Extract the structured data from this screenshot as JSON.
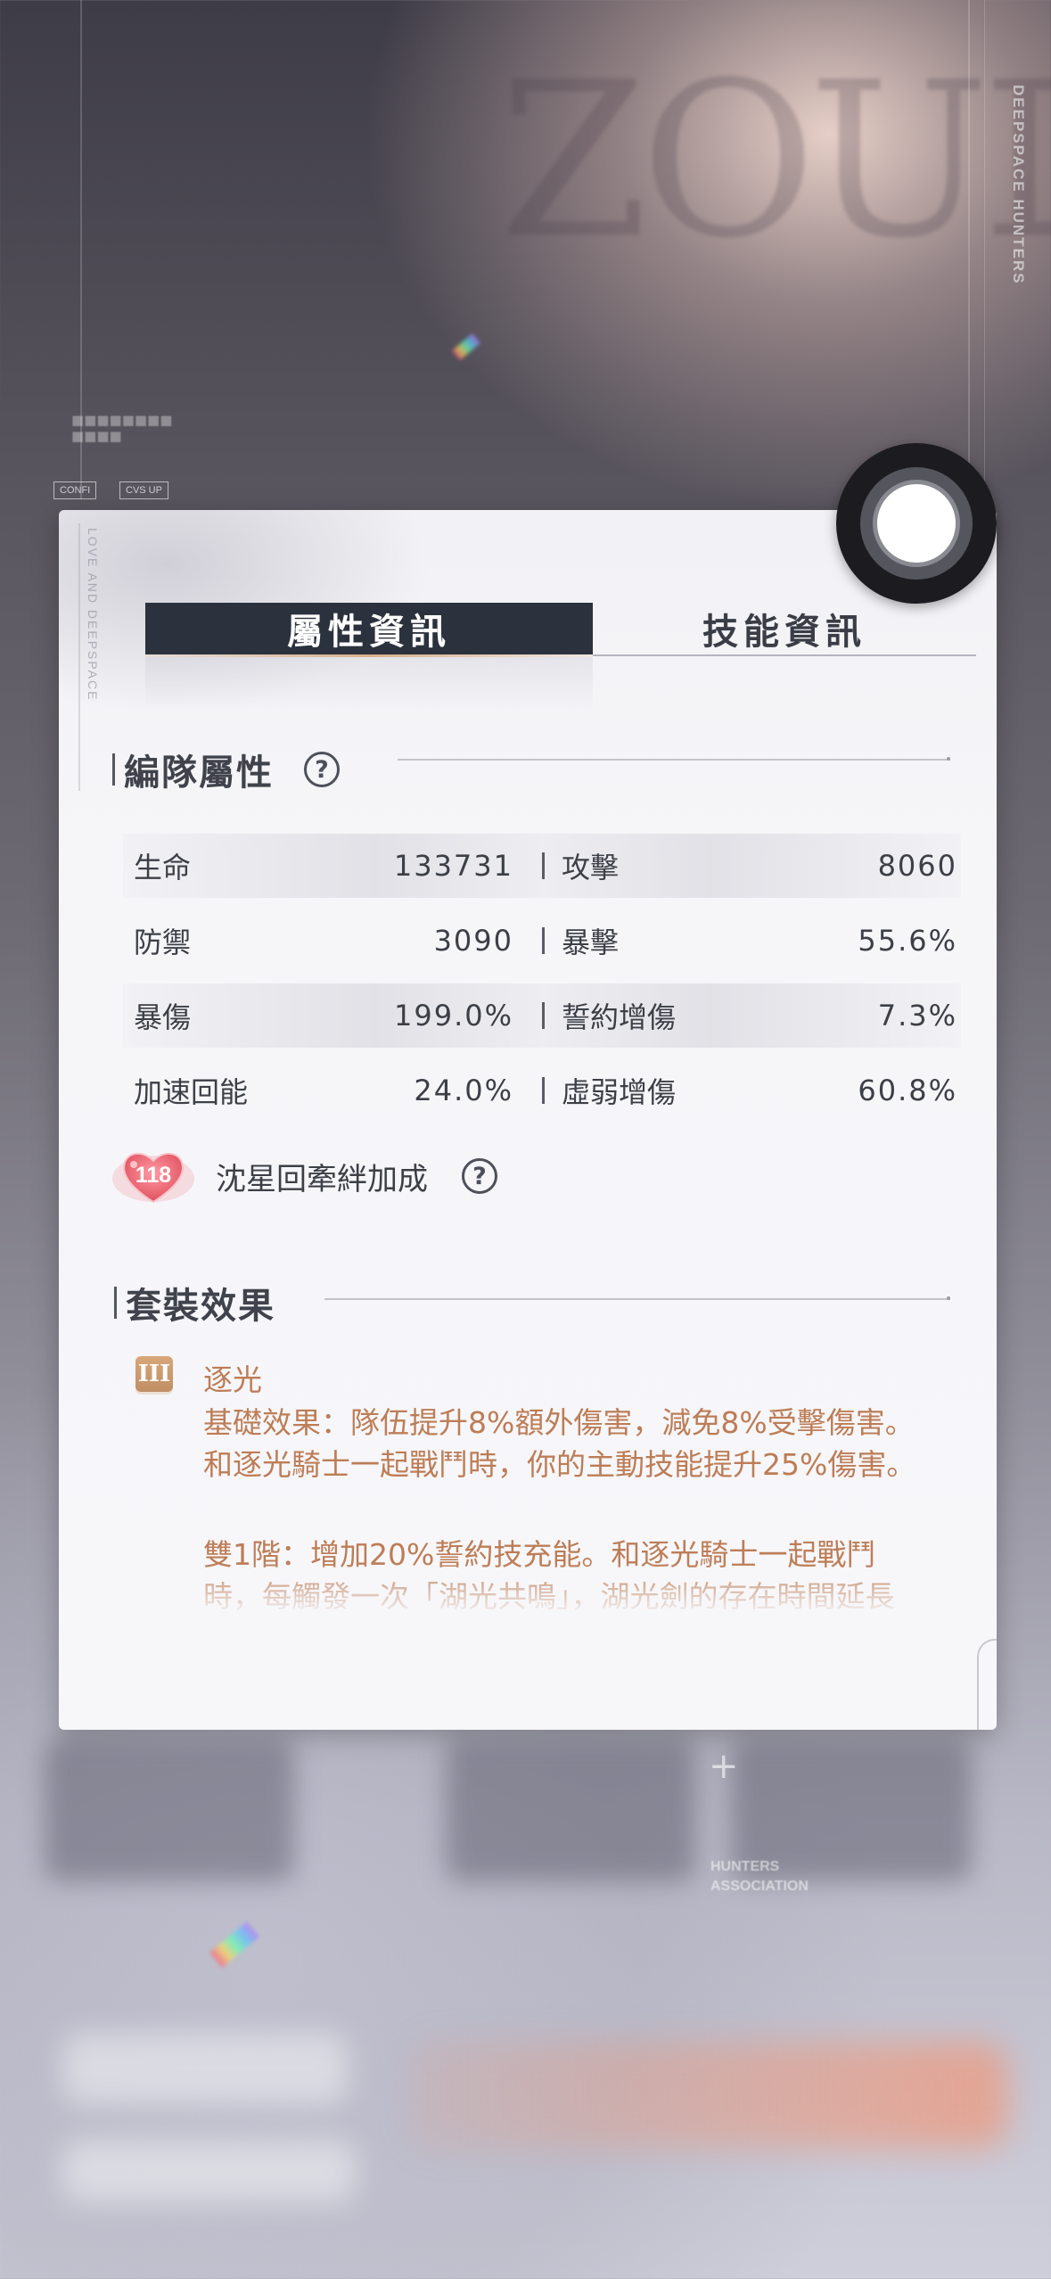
{
  "background": {
    "brand_vertical": "DEEPSPACE HUNTERS",
    "hunters_label": "HUNTERS\nASSOCIATION",
    "tags": [
      "CONFI",
      "CVS UP"
    ]
  },
  "panel": {
    "vertical_text": "LOVE AND DEEPSPACE",
    "tabs": [
      {
        "label": "屬性資訊",
        "active": true
      },
      {
        "label": "技能資訊",
        "active": false
      }
    ],
    "team_stats": {
      "title": "編隊屬性",
      "help": "?",
      "rows": [
        {
          "left": {
            "label": "生命",
            "value": "133731"
          },
          "right": {
            "label": "攻擊",
            "value": "8060"
          }
        },
        {
          "left": {
            "label": "防禦",
            "value": "3090"
          },
          "right": {
            "label": "暴擊",
            "value": "55.6%"
          }
        },
        {
          "left": {
            "label": "暴傷",
            "value": "199.0%"
          },
          "right": {
            "label": "誓約增傷",
            "value": "7.3%"
          }
        },
        {
          "left": {
            "label": "加速回能",
            "value": "24.0%"
          },
          "right": {
            "label": "虛弱增傷",
            "value": "60.8%"
          }
        }
      ]
    },
    "bond": {
      "level": "118",
      "label": "沈星回牽絆加成",
      "help": "?"
    },
    "set_effect": {
      "title": "套裝效果",
      "tier_icon": "III",
      "name": "逐光",
      "base": "基礎效果：隊伍提升8%額外傷害，減免8%受擊傷害。和逐光騎士一起戰鬥時，你的主動技能提升25%傷害。",
      "tier2": "雙1階：增加20%誓約技充能。和逐光騎士一起戰鬥時，每觸發一次「湖光共鳴」，湖光劍的存在時間延長"
    }
  },
  "colors": {
    "tab_active_bg": "#2b313d",
    "accent_text": "#bd7d56",
    "tier_icon_bg": "#c99a6e"
  }
}
